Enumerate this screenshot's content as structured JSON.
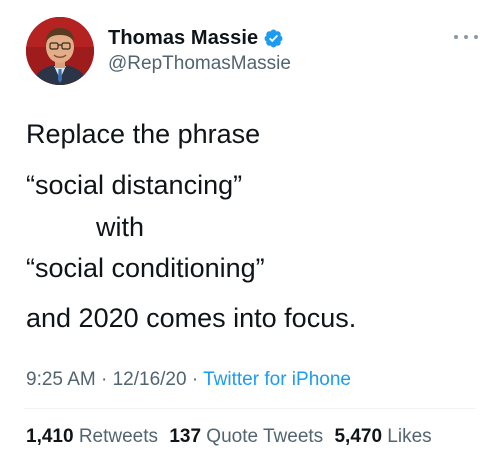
{
  "author": {
    "name": "Thomas Massie",
    "handle": "@RepThomasMassie",
    "verified_icon": "verified-badge-icon",
    "avatar_bg": "#a11a1a"
  },
  "tweet": {
    "lines": [
      "Replace the phrase",
      "“social distancing”",
      "with",
      "“social conditioning”",
      "and 2020 comes into focus."
    ],
    "time": "9:25 AM",
    "separator": "·",
    "date": "12/16/20",
    "source": "Twitter for iPhone"
  },
  "stats": {
    "retweets_count": "1,410",
    "retweets_label": "Retweets",
    "quotes_count": "137",
    "quotes_label": "Quote Tweets",
    "likes_count": "5,470",
    "likes_label": "Likes"
  },
  "colors": {
    "text": "#0f1419",
    "secondary": "#536471",
    "link": "#1d9bf0",
    "verified": "#1d9bf0"
  }
}
